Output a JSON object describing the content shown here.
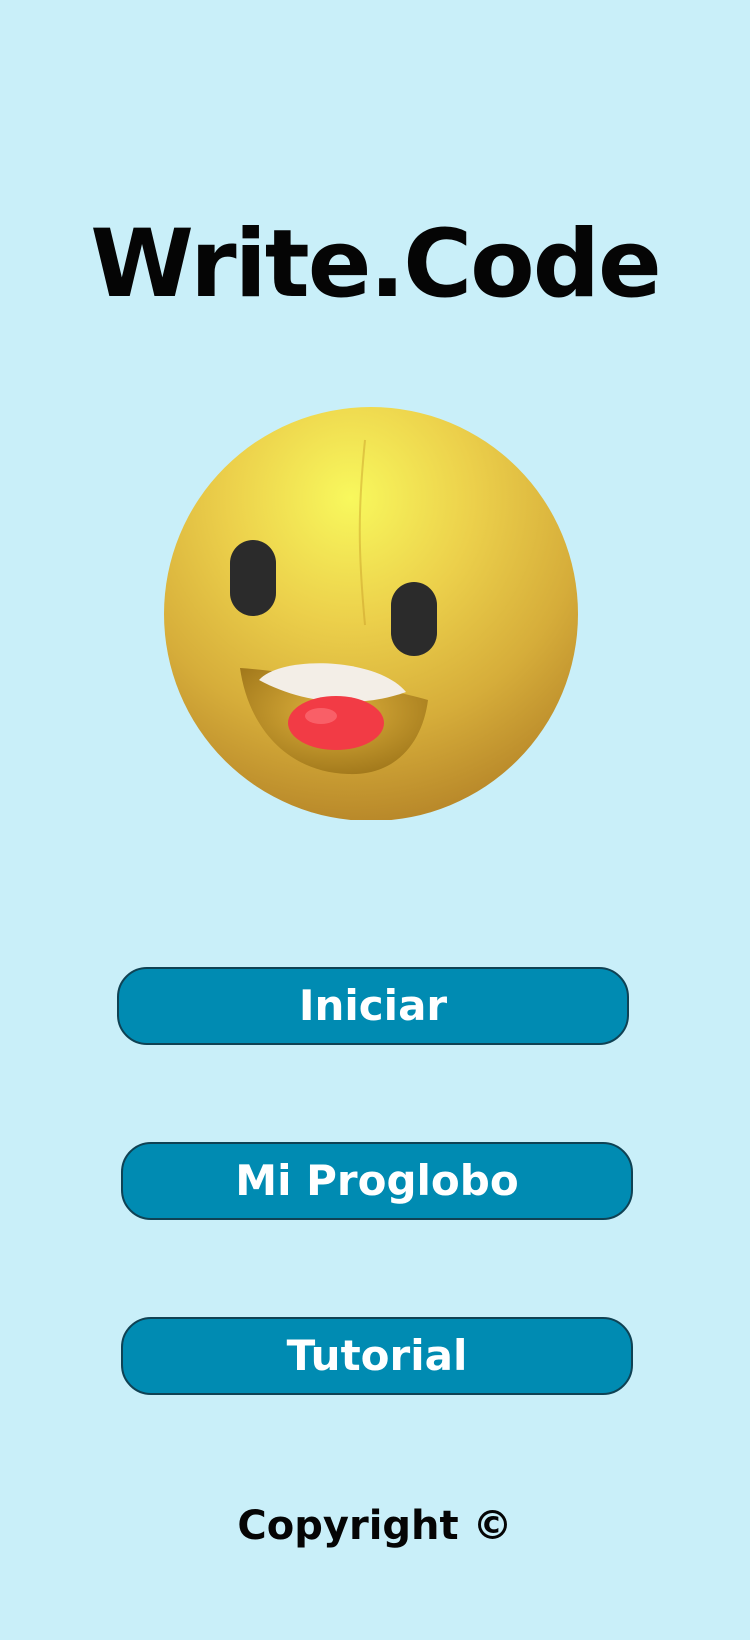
{
  "app": {
    "title": "Write.Code"
  },
  "mascot": {
    "icon": "surprised-emoji-icon",
    "colors": {
      "face_light": "#f5f55a",
      "face_dark": "#c99a2e",
      "eyes": "#2b2b2b",
      "teeth": "#f4efe6",
      "tongue": "#f23b45"
    }
  },
  "menu": {
    "buttons": [
      {
        "id": "start",
        "label": "Iniciar"
      },
      {
        "id": "proglobo",
        "label": "Mi Proglobo"
      },
      {
        "id": "tutorial",
        "label": "Tutorial"
      }
    ]
  },
  "footer": {
    "copyright": "Copyright ©"
  },
  "colors": {
    "background": "#c9eff9",
    "button_fill": "#008bb2",
    "button_border": "#0f4254",
    "button_text": "#ffffff",
    "text": "#050505"
  }
}
